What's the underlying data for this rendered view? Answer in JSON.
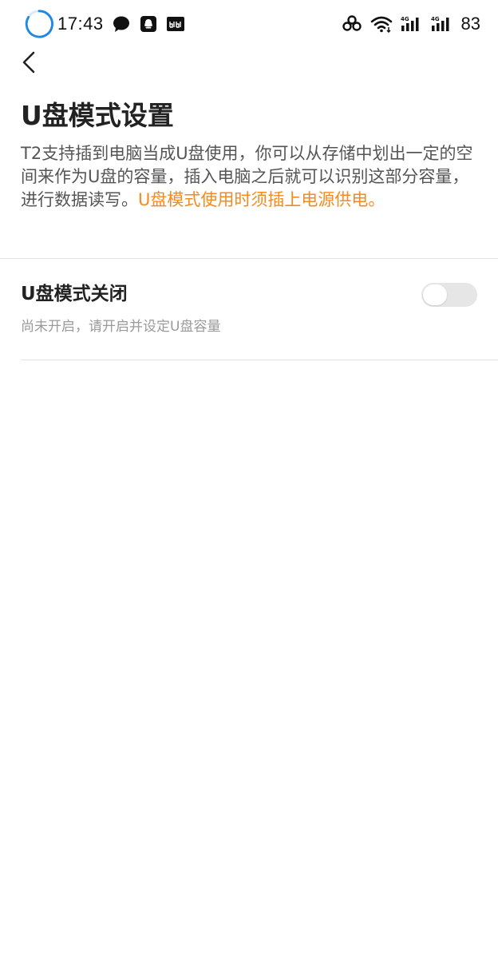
{
  "status_bar": {
    "time": "17:43",
    "battery": "83",
    "icons": [
      "loading-icon",
      "chat-bubble-icon",
      "qq-icon",
      "bilibili-icon",
      "link-icon",
      "wifi-icon",
      "signal-4g-icon",
      "signal-4g-icon"
    ]
  },
  "header": {
    "back_icon": "chevron-left-icon",
    "title": "U盘模式设置"
  },
  "description": {
    "text": "T2支持插到电脑当成U盘使用，你可以从存储中划出一定的空间来作为U盘的容量，插入电脑之后就可以识别这部分容量，进行数据读写。",
    "warning": "U盘模式使用时须插上电源供电。",
    "warning_color": "#f58a1f"
  },
  "setting": {
    "title": "U盘模式关闭",
    "subtitle": "尚未开启，请开启并设定U盘容量",
    "toggle_on": false
  }
}
